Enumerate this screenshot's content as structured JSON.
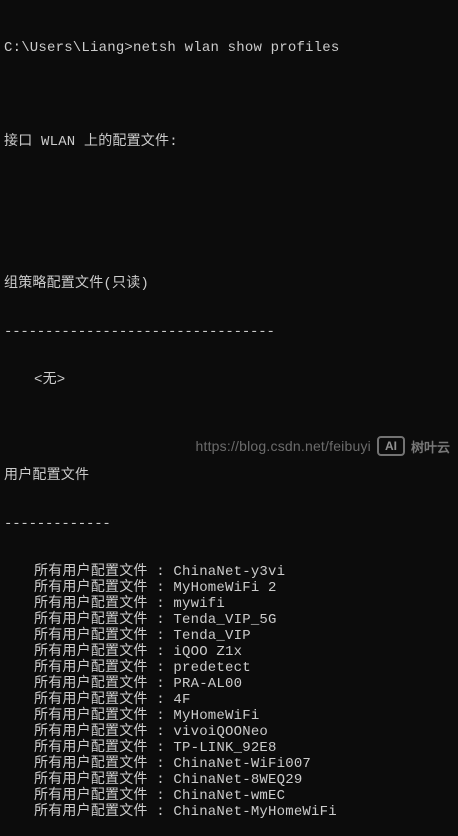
{
  "terminal": {
    "prompt": "C:\\Users\\Liang>",
    "command": "netsh wlan show profiles",
    "interface_line": "接口 WLAN 上的配置文件:",
    "group_policy_header": "组策略配置文件(只读)",
    "group_policy_divider": "---------------------------------",
    "group_policy_none": "<无>",
    "user_profiles_header": "用户配置文件",
    "user_profiles_divider": "-------------",
    "entry_prefix": "所有用户配置文件 : ",
    "profiles": [
      "ChinaNet-y3vi",
      "MyHomeWiFi 2",
      "mywifi",
      "Tenda_VIP_5G",
      "Tenda_VIP",
      "iQOO Z1x",
      "predetect",
      "PRA-AL00",
      "4F",
      "MyHomeWiFi",
      "vivoiQOONeo",
      "TP-LINK_92E8",
      "ChinaNet-WiFi007",
      "ChinaNet-8WEQ29",
      "ChinaNet-wmEC",
      "ChinaNet-MyHomeWiFi"
    ]
  },
  "watermark": {
    "url": "https://blog.csdn.net/feibuyi",
    "logo_text": "AI",
    "brand_text": "树叶云"
  }
}
